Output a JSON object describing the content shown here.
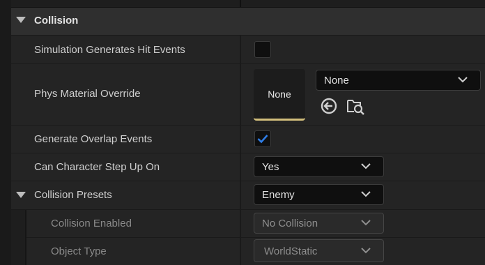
{
  "section": {
    "title": "Collision"
  },
  "rows": {
    "hit_events": {
      "label": "Simulation Generates Hit Events",
      "checked": false
    },
    "phys_material": {
      "label": "Phys Material Override",
      "thumbnail_text": "None",
      "dropdown_value": "None",
      "icons": [
        "use-selected-arrow-icon",
        "browse-folder-icon"
      ]
    },
    "overlap_events": {
      "label": "Generate Overlap Events",
      "checked": true
    },
    "step_up": {
      "label": "Can Character Step Up On",
      "value": "Yes"
    },
    "presets": {
      "label": "Collision Presets",
      "value": "Enemy"
    },
    "collision_enabled": {
      "label": "Collision Enabled",
      "value": "No Collision",
      "disabled": true
    },
    "object_type": {
      "label": "Object Type",
      "value": "WorldStatic",
      "disabled": true
    }
  },
  "colors": {
    "accent_check": "#2f7ee8",
    "thumbnail_underline": "#d2bf7c"
  }
}
